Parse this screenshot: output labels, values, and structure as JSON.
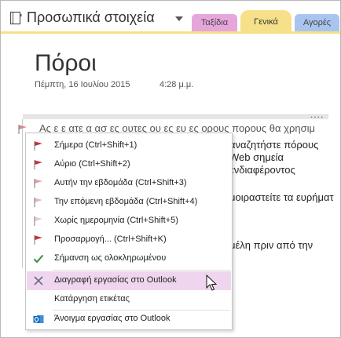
{
  "notebook": {
    "title": "Προσωπικά στοιχεία",
    "caret_icon": "chevron-down-icon"
  },
  "tabs": [
    {
      "label": "Ταξίδια",
      "color": "#e6a6dc"
    },
    {
      "label": "Γενικά",
      "color": "#f6e08a",
      "active": true
    },
    {
      "label": "Αγορές",
      "color": "#a9c5ef"
    }
  ],
  "page": {
    "title": "Πόροι",
    "date": "Πέμπτη, 16 Ιουλίου 2015",
    "time": "4:28 μ.μ.",
    "more": "...."
  },
  "note": {
    "lines": [
      "Ας ε ε ατε α ασ ες ουτες ου ες ευ ες ορους πορους θα χρησιμ",
      "αναζητήστε πόρους",
      "Web σημεία",
      "ενδιαφέροντος",
      "μοιραστείτε τα ευρήματ",
      "μέλη πριν από την"
    ]
  },
  "menu": {
    "items": [
      {
        "label": "Σήμερα (Ctrl+Shift+1)",
        "icon": "red-flag-icon"
      },
      {
        "label": "Αύριο (Ctrl+Shift+2)",
        "icon": "red-flag-icon"
      },
      {
        "label": "Αυτήν την εβδομάδα (Ctrl+Shift+3)",
        "icon": "pink-flag-icon"
      },
      {
        "label": "Την επόμενη εβδομάδα (Ctrl+Shift+4)",
        "icon": "pink-flag-icon"
      },
      {
        "label": "Χωρίς ημερομηνία (Ctrl+Shift+5)",
        "icon": "pink-flag-icon"
      },
      {
        "label": "Προσαρμογή... (Ctrl+Shift+K)",
        "icon": "red-flag-icon"
      },
      {
        "label": "Σήμανση ως ολοκληρωμένου",
        "icon": "checkmark-icon"
      },
      {
        "label": "Διαγραφή εργασίας στο Outlook",
        "icon": "delete-x-icon",
        "highlighted": true
      },
      {
        "label": "Κατάργηση ετικέτας",
        "icon": ""
      },
      {
        "label": "Άνοιγμα εργασίας στο Outlook",
        "icon": "outlook-icon"
      }
    ]
  },
  "colors": {
    "flag_red": "#c9323a",
    "flag_pink": "#d98b8d",
    "check_green": "#3a8c3a",
    "highlight": "#efd6ee",
    "outlook_blue": "#0b63b8"
  }
}
